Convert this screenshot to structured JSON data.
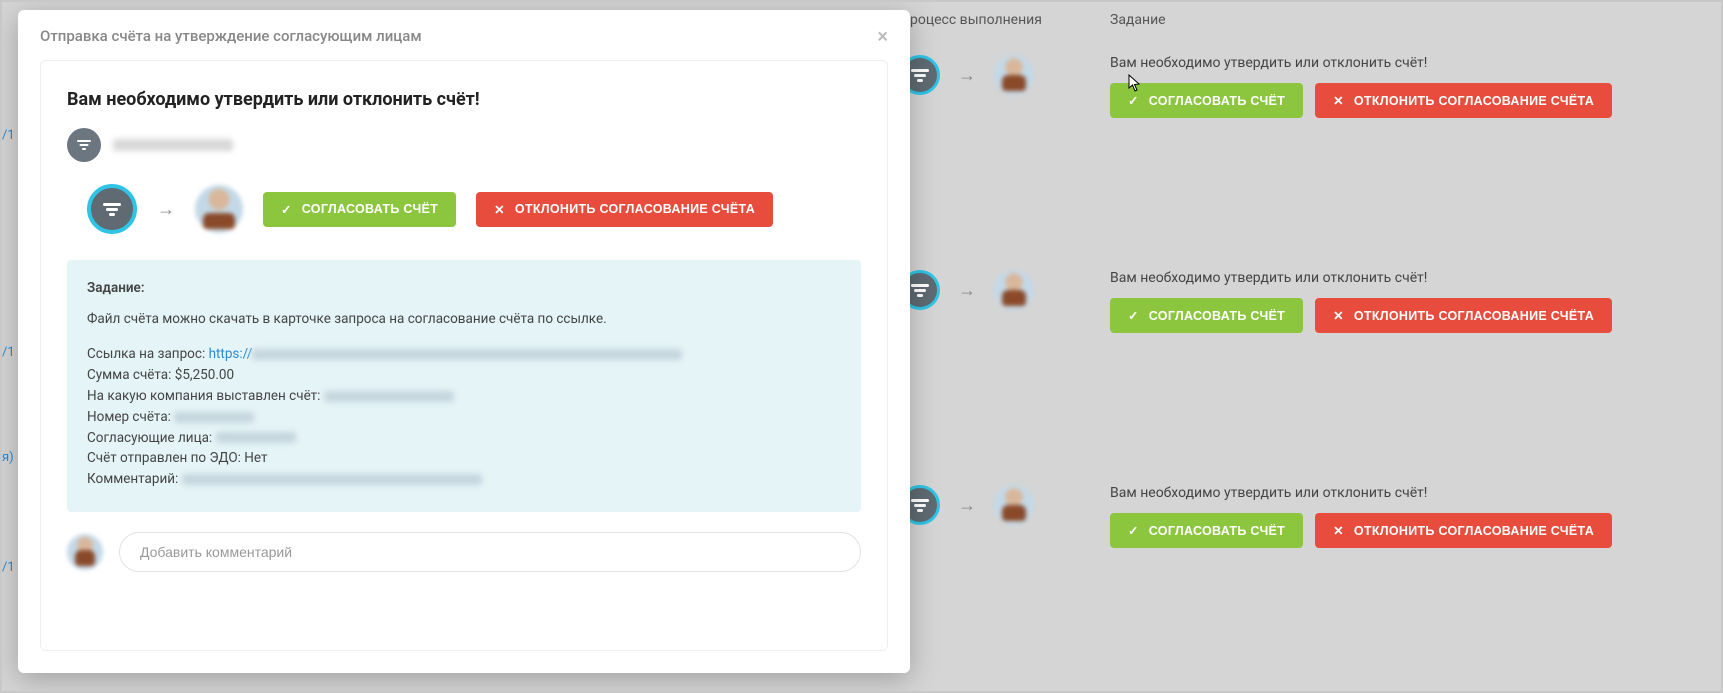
{
  "background": {
    "columns": {
      "process": "Процесс выполнения",
      "task": "Задание"
    },
    "row_title": "Вам необходимо утвердить или отклонить счёт!",
    "approve_label": "СОГЛАСОВАТЬ СЧЁТ",
    "reject_label": "ОТКЛОНИТЬ СОГЛАСОВАНИЕ СЧЁТА",
    "edge_labels": [
      "/1",
      "/1",
      "я)",
      "/1"
    ]
  },
  "modal": {
    "header_title": "Отправка счёта на утверждение согласующим лицам",
    "title": "Вам необходимо утвердить или отклонить счёт!",
    "approve_label": "СОГЛАСОВАТЬ СЧЁТ",
    "reject_label": "ОТКЛОНИТЬ СОГЛАСОВАНИЕ СЧЁТА",
    "task": {
      "heading": "Задание:",
      "description": "Файл счёта можно скачать в карточке запроса на согласование счёта по ссылке.",
      "link_label": "Ссылка на запрос:",
      "link_prefix": "https://",
      "amount_label": "Сумма счёта:",
      "amount_value": "$5,250.00",
      "company_label": "На какую компания выставлен счёт:",
      "invoice_no_label": "Номер счёта:",
      "approvers_label": "Согласующие лица:",
      "edo_label": "Счёт отправлен по ЭДО:",
      "edo_value": "Нет",
      "comment_label": "Комментарий:"
    },
    "comment_placeholder": "Добавить комментарий"
  }
}
